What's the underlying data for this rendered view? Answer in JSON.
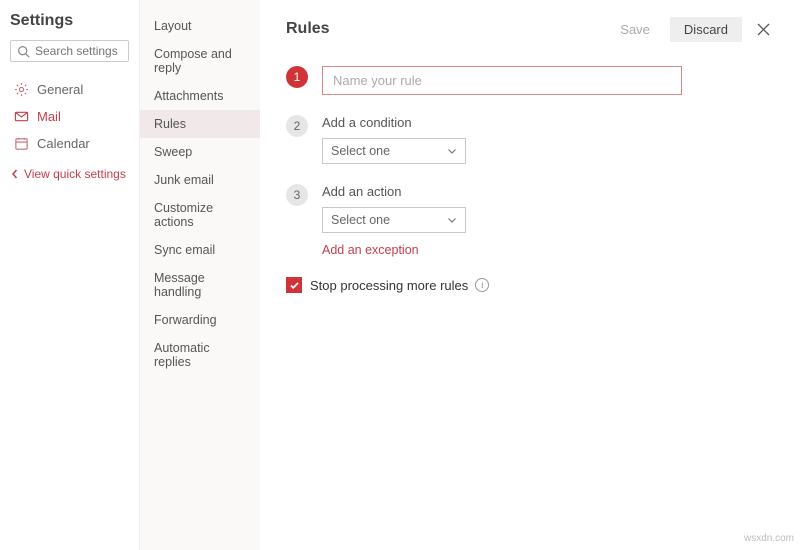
{
  "sidebar": {
    "title": "Settings",
    "search_placeholder": "Search settings",
    "items": [
      {
        "label": "General"
      },
      {
        "label": "Mail"
      },
      {
        "label": "Calendar"
      }
    ],
    "quick_link": "View quick settings"
  },
  "submenu": {
    "items": [
      "Layout",
      "Compose and reply",
      "Attachments",
      "Rules",
      "Sweep",
      "Junk email",
      "Customize actions",
      "Sync email",
      "Message handling",
      "Forwarding",
      "Automatic replies"
    ],
    "active_index": 3
  },
  "main": {
    "title": "Rules",
    "save_label": "Save",
    "discard_label": "Discard",
    "step1": {
      "num": "1",
      "placeholder": "Name your rule"
    },
    "step2": {
      "num": "2",
      "label": "Add a condition",
      "select": "Select one"
    },
    "step3": {
      "num": "3",
      "label": "Add an action",
      "select": "Select one",
      "exception": "Add an exception"
    },
    "stop_label": "Stop processing more rules",
    "stop_checked": true
  },
  "watermark": "wsxdn.com"
}
